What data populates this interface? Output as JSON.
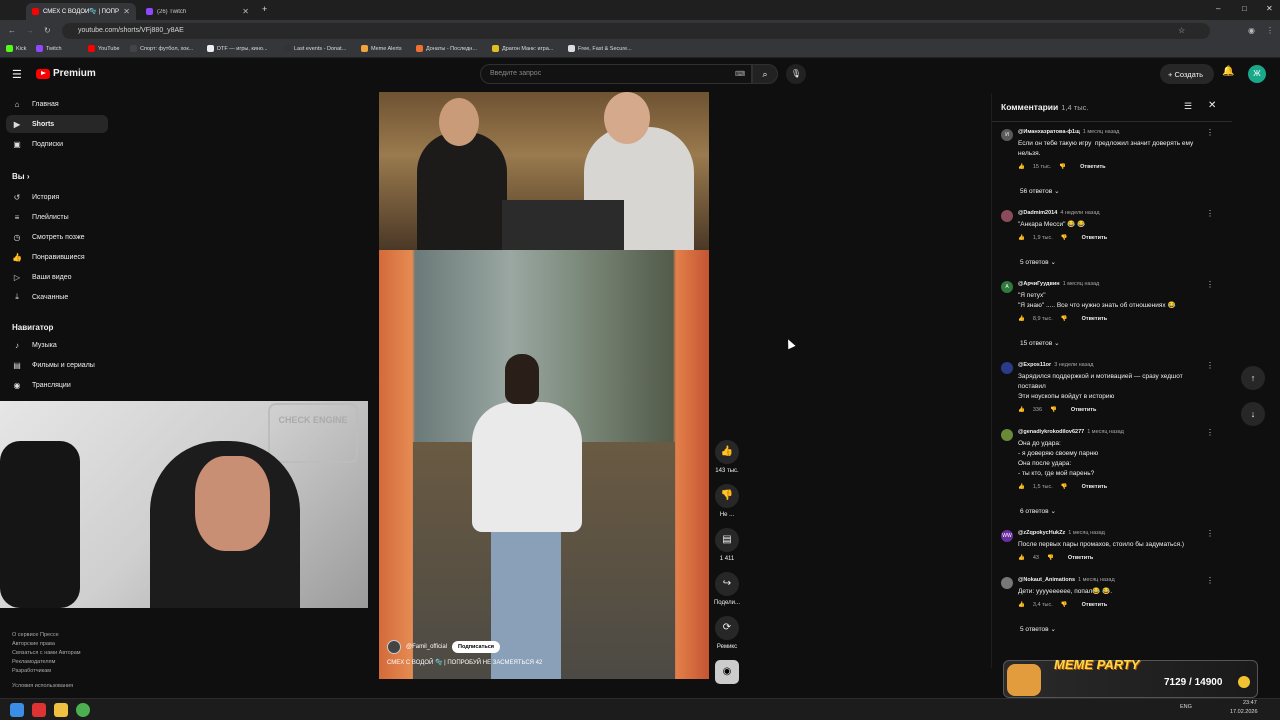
{
  "browser": {
    "tabs": [
      {
        "label": "СМЕХ С ВОДОЙ🫧 | ПОПР",
        "active": true
      },
      {
        "label": "(26) Twitch",
        "active": false
      }
    ],
    "new_tab": "+",
    "url": "youtube.com/shorts/VFj880_y8AE",
    "window_controls": [
      "–",
      "□",
      "✕"
    ],
    "bookmarks": [
      "Kick",
      "Twitch",
      "YouTube",
      "Спорт: футбол, хок...",
      "DTF — игры, кино...",
      "Last events - Donat...",
      "Meme Alerts",
      "Донаты - Последн...",
      "Драгон Манк: игра...",
      "Free, Fast & Secure..."
    ]
  },
  "header": {
    "logo": "Premium",
    "search_placeholder": "Введите запрос",
    "create_label": "Создать",
    "avatar_letter": "Ж"
  },
  "sidebar": {
    "main": [
      {
        "label": "Главная",
        "icon": "home-icon"
      },
      {
        "label": "Shorts",
        "icon": "shorts-icon"
      },
      {
        "label": "Подписки",
        "icon": "subscriptions-icon"
      }
    ],
    "you_header": "Вы",
    "you": [
      {
        "label": "История",
        "icon": "history-icon"
      },
      {
        "label": "Плейлисты",
        "icon": "playlists-icon"
      },
      {
        "label": "Смотреть позже",
        "icon": "watch-later-icon"
      },
      {
        "label": "Понравившиеся",
        "icon": "like-icon"
      },
      {
        "label": "Ваши видео",
        "icon": "your-videos-icon"
      },
      {
        "label": "Скачанные",
        "icon": "download-icon"
      }
    ],
    "nav_header": "Навигатор",
    "nav": [
      {
        "label": "Музыка",
        "icon": "music-icon"
      },
      {
        "label": "Фильмы и сериалы",
        "icon": "movies-icon"
      },
      {
        "label": "Трансляции",
        "icon": "live-icon"
      }
    ],
    "footer": [
      "О сервисе  Прессе",
      "Авторские права",
      "Связаться с нами  Авторам",
      "Рекламодателям",
      "Разработчикам",
      "Условия использования"
    ]
  },
  "video": {
    "channel": "@Famil_official",
    "subscribe": "Подписаться",
    "title": "СМЕХ С ВОДОЙ 🫧 | ПОПРОБУЙ НЕ ЗАСМЕЯТЬСЯ 42",
    "actions": [
      {
        "icon": "like-icon",
        "count": "143 тыс."
      },
      {
        "icon": "dislike-icon",
        "count": "Не ..."
      },
      {
        "icon": "comment-icon",
        "count": "1 411"
      },
      {
        "icon": "share-icon",
        "count": "Подели..."
      },
      {
        "icon": "remix-icon",
        "count": "Ремикс"
      }
    ]
  },
  "webcam": {
    "sign": "CHECK ENGINE"
  },
  "comments": {
    "title": "Комментарии",
    "count": "1,4 тыс.",
    "reply_label": "Ответить",
    "items": [
      {
        "user": "@Иманхазратова-ф1щ",
        "ago": "1 месяц назад",
        "lines": [
          "Если он тебе такую игру  предложил значит доверять ему",
          "нельзя."
        ],
        "likes": "15 тыс.",
        "replies": "56 ответов",
        "avatar_color": "#5a5a5a",
        "avatar_letter": "И"
      },
      {
        "user": "@Dadmim2014",
        "ago": "4 недели назад",
        "lines": [
          "\"Анкара Месси\" 😂 😂"
        ],
        "likes": "1,9 тыс.",
        "replies": "5 ответов",
        "avatar_color": "#8a4b5a",
        "avatar_letter": ""
      },
      {
        "user": "@АрчиГуудвин",
        "ago": "1 месяц назад",
        "lines": [
          "\"Я петух\"",
          "\"Я знаю\" ..... Все что нужно знать об отношениях 😂"
        ],
        "likes": "8,9 тыс.",
        "replies": "15 ответов",
        "avatar_color": "#2f7a3c",
        "avatar_letter": "А"
      },
      {
        "user": "@Expos11or",
        "ago": "3 недели назад",
        "lines": [
          "Зарядился поддержкой и мотивацией — сразу хедшот",
          "поставил",
          "Эти ноускопы войдут в историю"
        ],
        "likes": "336",
        "replies": "",
        "avatar_color": "#2b3a8a",
        "avatar_letter": ""
      },
      {
        "user": "@genadiykrokodilov6277",
        "ago": "1 месяц назад",
        "lines": [
          "Она до удара:",
          "- я доверяю своему парню",
          "Она после удара:",
          "- ты кто, где мой парень?"
        ],
        "likes": "1,5 тыс.",
        "replies": "6 ответов",
        "avatar_color": "#6a8a3a",
        "avatar_letter": ""
      },
      {
        "user": "@zZqpokycHukZz",
        "ago": "1 месяц назад",
        "lines": [
          "После первых пары промахов, стоило бы задуматься.)"
        ],
        "likes": "43",
        "replies": "",
        "avatar_color": "#6a2fa0",
        "avatar_letter": "WW"
      },
      {
        "user": "@Nokaut_Animations",
        "ago": "1 месяц назад",
        "lines": [
          "Дети: ууууееееее, попал😂 😂."
        ],
        "likes": "3,4 тыс.",
        "replies": "5 ответов",
        "avatar_color": "#777777",
        "avatar_letter": ""
      }
    ]
  },
  "meme_party": {
    "title": "MEME PARTY",
    "progress_text": "7129 / 14900"
  },
  "taskbar": {
    "lang": "ENG",
    "time": "23:47",
    "date": "17.02.2026"
  }
}
